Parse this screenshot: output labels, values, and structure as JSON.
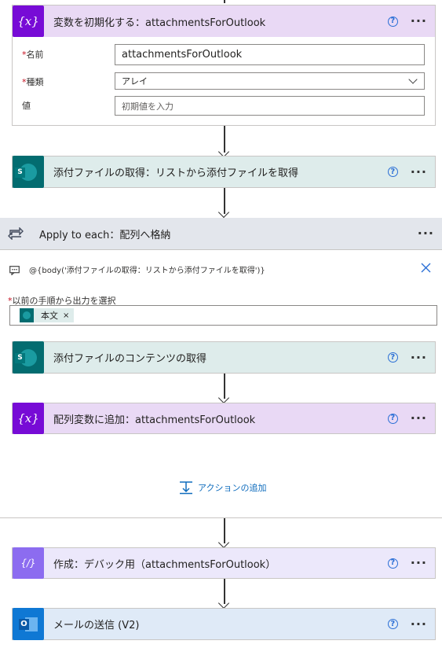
{
  "init_var": {
    "title": "変数を初期化する：attachmentsForOutlook",
    "icon_label": "{x}",
    "name_label": "名前",
    "name_value": "attachmentsForOutlook",
    "type_label": "種類",
    "type_value": "アレイ",
    "value_label": "値",
    "value_placeholder": "初期値を入力",
    "required_mark": "*"
  },
  "get_attachments": {
    "title": "添付ファイルの取得：リストから添付ファイルを取得",
    "icon_label": "S"
  },
  "apply_each": {
    "title": "Apply to each：配列へ格納",
    "expression": "@{body('添付ファイルの取得：リストから添付ファイルを取得')}",
    "select_label": "以前の手順から出力を選択",
    "token_label": "本文",
    "token_remove": "×"
  },
  "get_content": {
    "title": "添付ファイルのコンテンツの取得",
    "icon_label": "S"
  },
  "append_var": {
    "title": "配列変数に追加：attachmentsForOutlook",
    "icon_label": "{x}"
  },
  "add_action": {
    "label": "アクションの追加"
  },
  "compose": {
    "title": "作成：デバック用（attachmentsForOutlook）",
    "icon_label": "{/}"
  },
  "send_mail": {
    "title": "メールの送信 (V2)",
    "icon_label": "O"
  },
  "common": {
    "help": "?",
    "more": "···"
  },
  "colors": {
    "variable_bg": "#e9d9f5",
    "variable_icon": "#770bd6",
    "sharepoint_bg": "#deeceb",
    "sharepoint_icon": "#036c70",
    "loop_bg": "#e3e6ec",
    "compose_bg": "#ece8fb",
    "compose_icon": "#8c6cf0",
    "outlook_bg": "#dfeaf7",
    "outlook_icon": "#0f78d4"
  }
}
